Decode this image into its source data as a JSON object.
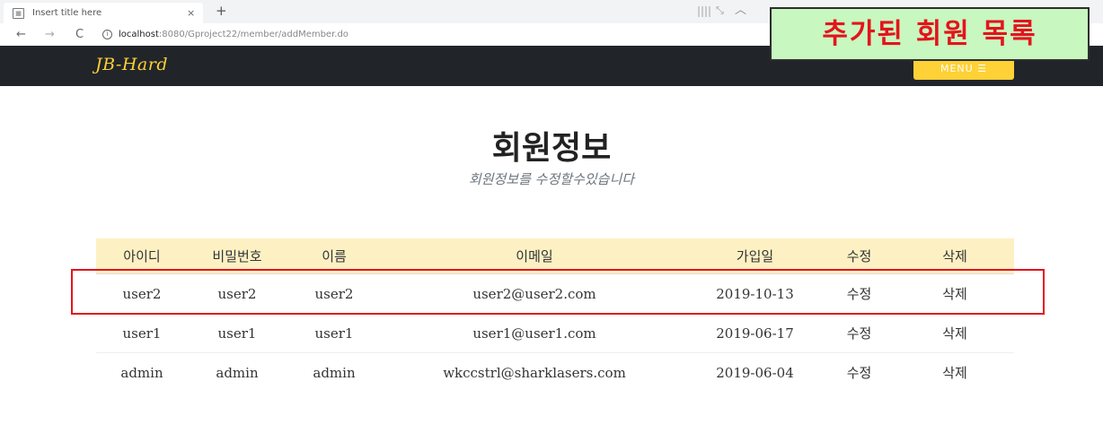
{
  "browser": {
    "tab_title": "Insert title here",
    "tab_close": "×",
    "new_tab": "+",
    "url_host": "localhost",
    "url_rest": ":8080/Gproject22/member/addMember.do"
  },
  "header": {
    "logo": "JB-Hard",
    "menu_label": "MENU ☰"
  },
  "overlay": {
    "label": "추가된 회원 목록"
  },
  "page": {
    "title": "회원정보",
    "subtitle": "회원정보를 수정할수있습니다"
  },
  "table": {
    "columns": [
      "아이디",
      "비밀번호",
      "이름",
      "이메일",
      "가입일",
      "수정",
      "삭제"
    ],
    "rows": [
      {
        "id": "user2",
        "password": "user2",
        "name": "user2",
        "email": "user2@user2.com",
        "joined": "2019-10-13",
        "edit": "수정",
        "delete": "삭제"
      },
      {
        "id": "user1",
        "password": "user1",
        "name": "user1",
        "email": "user1@user1.com",
        "joined": "2019-06-17",
        "edit": "수정",
        "delete": "삭제"
      },
      {
        "id": "admin",
        "password": "admin",
        "name": "admin",
        "email": "wkccstrl@sharklasers.com",
        "joined": "2019-06-04",
        "edit": "수정",
        "delete": "삭제"
      }
    ]
  },
  "colors": {
    "header_bg": "#212529",
    "accent": "#fed136",
    "table_head_bg": "#fdf1c4",
    "highlight": "#e4141b",
    "overlay_bg": "#c8f7c0"
  }
}
